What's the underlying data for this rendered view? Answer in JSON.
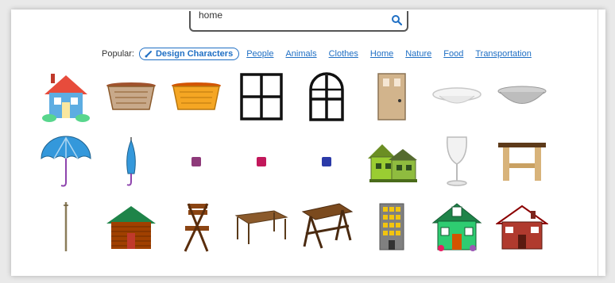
{
  "search": {
    "value": "home"
  },
  "popular": {
    "label": "Popular:",
    "chip": "Design Characters",
    "links": [
      "People",
      "Animals",
      "Clothes",
      "Home",
      "Nature",
      "Food",
      "Transportation"
    ]
  },
  "icons": {
    "row1": [
      "house-icon",
      "basket-icon",
      "basket-orange-icon",
      "window-icon",
      "arched-window-icon",
      "door-icon",
      "plate-icon",
      "bowl-icon"
    ],
    "row2": [
      "open-umbrella-icon",
      "closed-umbrella-icon",
      "purple-cushion-icon",
      "magenta-cushion-icon",
      "blue-cushion-icon",
      "green-house-icon",
      "wine-glass-icon",
      "stool-icon"
    ],
    "row3": [
      "walking-stick-icon",
      "log-cabin-icon",
      "folding-chair-icon",
      "brown-table-icon",
      "picnic-table-icon",
      "apartment-building-icon",
      "green-cottage-icon",
      "red-cottage-icon"
    ]
  },
  "colors": {
    "link": "#1f6fc4",
    "border": "#555555"
  }
}
